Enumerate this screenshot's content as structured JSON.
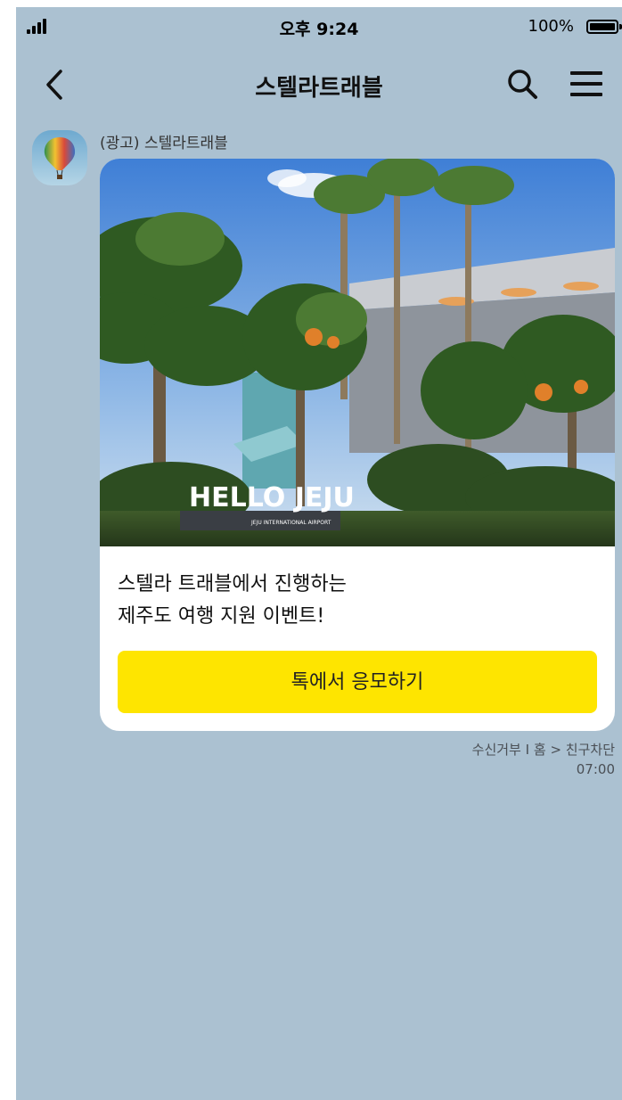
{
  "status_bar": {
    "time": "오후 9:24",
    "battery_percent": "100%",
    "battery_level": 1.0
  },
  "header": {
    "title": "스텔라트래블",
    "back_icon": "chevron-left-icon",
    "search_icon": "search-icon",
    "menu_icon": "hamburger-menu-icon"
  },
  "message": {
    "sender": "(광고) 스텔라트래블",
    "avatar_icon": "hot-air-balloon-icon",
    "image_sign_text": "HELLO JEJU",
    "image_sign_subtext": "JEJU INTERNATIONAL AIRPORT",
    "text_lines": [
      "스텔라 트래블에서 진행하는",
      "제주도 여행 지원 이벤트!"
    ],
    "button_label": "톡에서 응모하기",
    "footer": {
      "unsubscribe": "수신거부",
      "separator": "I",
      "home": "홈",
      "arrow": ">",
      "block": "친구차단"
    },
    "time": "07:00"
  },
  "colors": {
    "chat_background": "#abc1d1",
    "button_yellow": "#fee500"
  }
}
